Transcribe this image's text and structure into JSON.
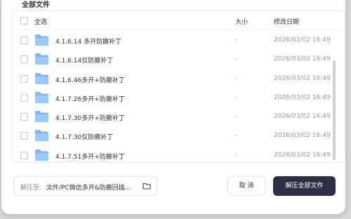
{
  "dialog": {
    "section_title": "全部文件",
    "list": {
      "header": {
        "select_all_label": "全选",
        "col_size": "大小",
        "col_modified": "修改日期"
      },
      "rows": [
        {
          "name": "4.1.6.14 多开防撤补丁",
          "size": "-",
          "modified": "2026/03/02 16:49"
        },
        {
          "name": "4.1.6.14仅防撤补丁",
          "size": "-",
          "modified": "2026/03/02 16:49"
        },
        {
          "name": "4.1.6.46多开+防撤补丁",
          "size": "-",
          "modified": "2026/03/02 16:49"
        },
        {
          "name": "4.1.7.26多开+防撤补丁",
          "size": "-",
          "modified": "2026/03/02 16:49"
        },
        {
          "name": "4.1.7.30多开+防撤补丁",
          "size": "-",
          "modified": "2026/03/02 16:49"
        },
        {
          "name": "4.1.7.30仅防撤补丁",
          "size": "-",
          "modified": "2026/03/02 16:49"
        },
        {
          "name": "4.1.7.51多开+防撤补丁",
          "size": "-",
          "modified": "2026/03/02 16:49"
        }
      ]
    },
    "extract_path": {
      "label": "解压至:",
      "value": "文件/PC微信多开&防撤回插..."
    },
    "buttons": {
      "cancel": "取 消",
      "extract_all": "解压全部文件"
    },
    "colors": {
      "primary_button": "#2e2f44",
      "folder": "#7fb7f5",
      "muted_text": "#999999"
    }
  }
}
